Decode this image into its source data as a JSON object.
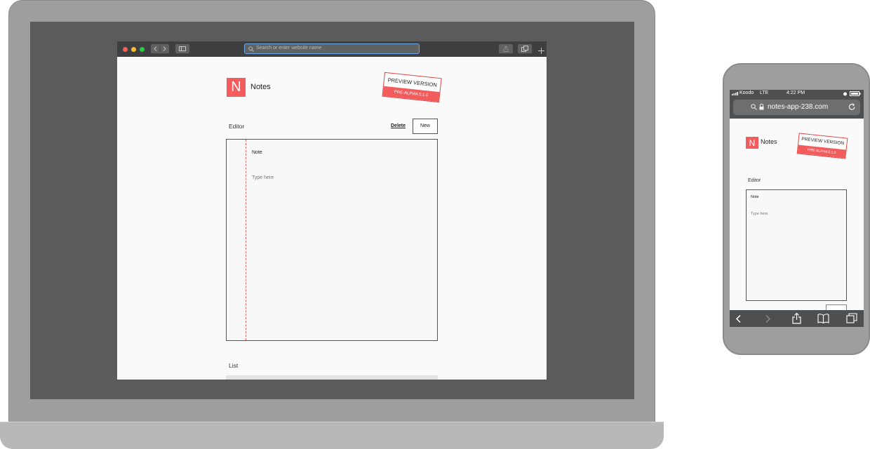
{
  "desktop": {
    "browser": {
      "address_placeholder": "Search or enter website name"
    },
    "app": {
      "logo_letter": "N",
      "title": "Notes",
      "badge": {
        "top": "PREVIEW VERSION",
        "bottom": "PRE-ALPHA 0.1.0"
      },
      "editor": {
        "heading": "Editor",
        "delete_label": "Delete",
        "new_label": "New",
        "note_title": "Note",
        "note_placeholder": "Type here"
      },
      "list": {
        "heading": "List"
      }
    }
  },
  "mobile": {
    "status": {
      "carrier": "Koodo",
      "network": "LTE",
      "time": "4:22 PM"
    },
    "url": "notes-app-238.com",
    "app": {
      "logo_letter": "N",
      "title": "Notes",
      "badge": {
        "top": "PREVIEW VERSION",
        "bottom": "PRE-ALPHA 0.1.0"
      },
      "editor": {
        "heading": "Editor",
        "note_title": "Note",
        "note_placeholder": "Type here"
      }
    }
  },
  "colors": {
    "accent": "#f25c5c",
    "browser_chrome": "#3d3f40",
    "device_frame": "#9e9e9e"
  }
}
